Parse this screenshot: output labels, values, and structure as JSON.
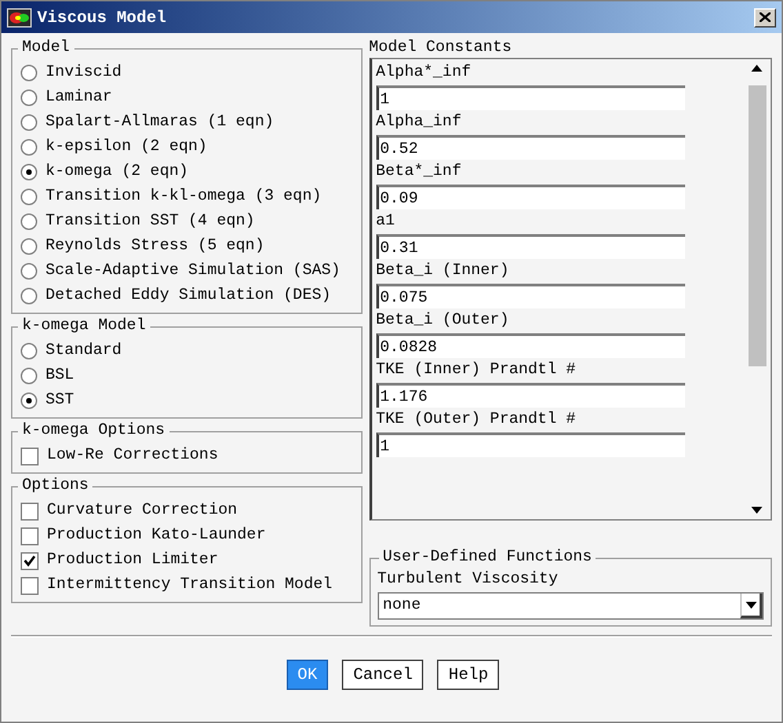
{
  "window": {
    "title": "Viscous Model"
  },
  "model": {
    "title": "Model",
    "options": [
      {
        "label": "Inviscid",
        "selected": false
      },
      {
        "label": "Laminar",
        "selected": false
      },
      {
        "label": "Spalart-Allmaras (1 eqn)",
        "selected": false
      },
      {
        "label": "k-epsilon (2 eqn)",
        "selected": false
      },
      {
        "label": "k-omega (2 eqn)",
        "selected": true
      },
      {
        "label": "Transition k-kl-omega (3 eqn)",
        "selected": false
      },
      {
        "label": "Transition SST (4 eqn)",
        "selected": false
      },
      {
        "label": "Reynolds Stress (5 eqn)",
        "selected": false
      },
      {
        "label": "Scale-Adaptive Simulation (SAS)",
        "selected": false
      },
      {
        "label": "Detached Eddy Simulation (DES)",
        "selected": false
      }
    ]
  },
  "k_omega_model": {
    "title": "k-omega Model",
    "options": [
      {
        "label": "Standard",
        "selected": false
      },
      {
        "label": "BSL",
        "selected": false
      },
      {
        "label": "SST",
        "selected": true
      }
    ]
  },
  "k_omega_options": {
    "title": "k-omega Options",
    "options": [
      {
        "label": "Low-Re Corrections",
        "checked": false
      }
    ]
  },
  "options": {
    "title": "Options",
    "options": [
      {
        "label": "Curvature Correction",
        "checked": false
      },
      {
        "label": "Production Kato-Launder",
        "checked": false
      },
      {
        "label": "Production Limiter",
        "checked": true
      },
      {
        "label": "Intermittency Transition Model",
        "checked": false
      }
    ]
  },
  "model_constants": {
    "title": "Model Constants",
    "fields": [
      {
        "label": "Alpha*_inf",
        "value": "1"
      },
      {
        "label": "Alpha_inf",
        "value": "0.52"
      },
      {
        "label": "Beta*_inf",
        "value": "0.09"
      },
      {
        "label": "a1",
        "value": "0.31"
      },
      {
        "label": "Beta_i (Inner)",
        "value": "0.075"
      },
      {
        "label": "Beta_i (Outer)",
        "value": "0.0828"
      },
      {
        "label": "TKE (Inner) Prandtl #",
        "value": "1.176"
      },
      {
        "label": "TKE (Outer) Prandtl #",
        "value": "1"
      }
    ]
  },
  "user_defined_functions": {
    "title": "User-Defined Functions",
    "field": {
      "label": "Turbulent Viscosity",
      "value": "none"
    }
  },
  "buttons": [
    {
      "label": "OK",
      "selected": true
    },
    {
      "label": "Cancel",
      "selected": false
    },
    {
      "label": "Help",
      "selected": false
    }
  ]
}
